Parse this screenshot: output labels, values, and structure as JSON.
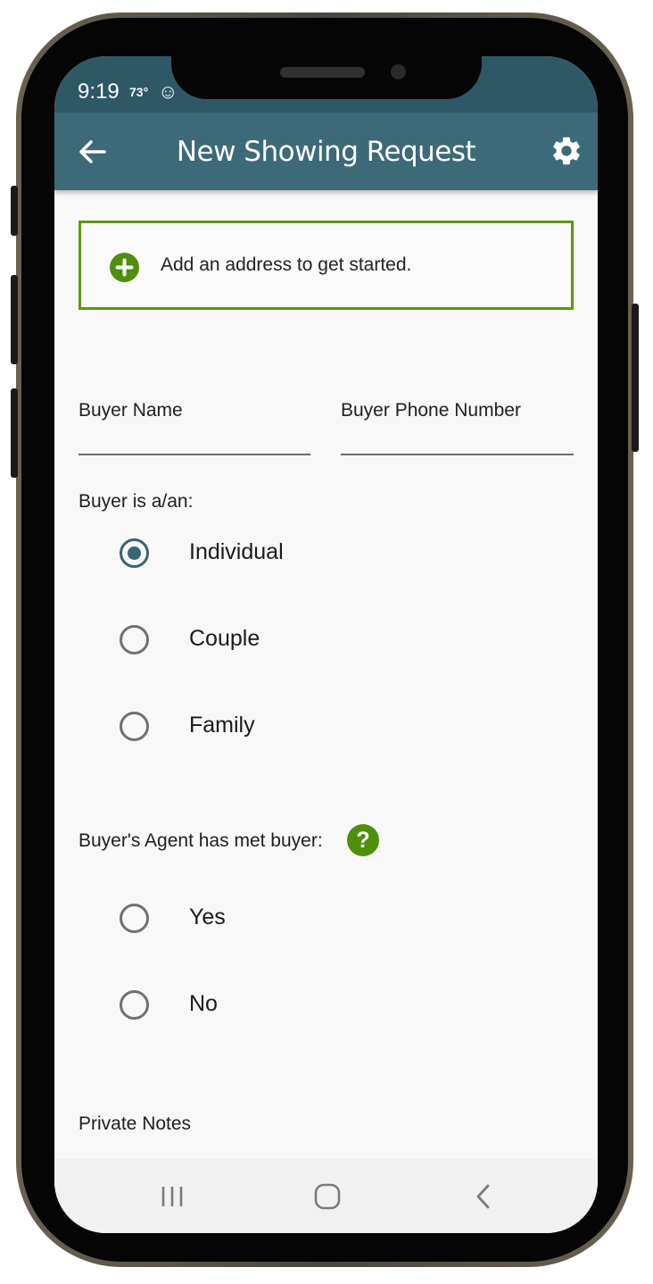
{
  "status_bar": {
    "time": "9:19",
    "temperature": "73°",
    "icon": "person-notification-icon"
  },
  "app_bar": {
    "title": "New Showing Request",
    "back_icon": "back-arrow-icon",
    "settings_icon": "gear-icon"
  },
  "address_prompt": {
    "text": "Add an address to get started.",
    "icon": "add-circle-icon"
  },
  "buyer_name": {
    "label": "Buyer Name",
    "value": ""
  },
  "buyer_phone": {
    "label": "Buyer Phone Number",
    "value": ""
  },
  "buyer_type": {
    "label": "Buyer is a/an:",
    "selected": "Individual",
    "options": [
      {
        "label": "Individual",
        "checked": true
      },
      {
        "label": "Couple",
        "checked": false
      },
      {
        "label": "Family",
        "checked": false
      }
    ]
  },
  "agent_met": {
    "label": "Buyer's Agent has met buyer:",
    "help_icon": "help-circle-icon",
    "help_glyph": "?",
    "options": [
      {
        "label": "Yes",
        "checked": false
      },
      {
        "label": "No",
        "checked": false
      }
    ]
  },
  "private_notes": {
    "label": "Private Notes"
  },
  "nav_bar": {
    "recents_icon": "recent-apps-icon",
    "home_icon": "home-icon",
    "back_icon": "nav-back-icon"
  },
  "colors": {
    "app_bar": "#3c6a78",
    "status_bar": "#2f5866",
    "accent_green": "#5a9a0a",
    "radio_selected": "#3a6473"
  }
}
